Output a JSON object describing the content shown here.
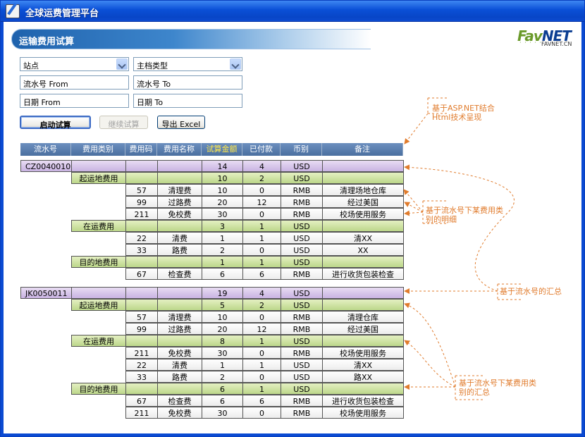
{
  "window": {
    "title": "全球运费管理平台"
  },
  "page": {
    "title": "运输费用试算"
  },
  "logo": {
    "text_fav": "Fav",
    "text_net": "NET",
    "sub": "FAVNET.CN"
  },
  "filters": {
    "site": {
      "value": "站点"
    },
    "master_type": {
      "value": "主档类型"
    },
    "serial_from": {
      "placeholder": "流水号 From"
    },
    "serial_to": {
      "placeholder": "流水号 To"
    },
    "date_from": {
      "placeholder": "日期 From"
    },
    "date_to": {
      "placeholder": "日期 To"
    }
  },
  "buttons": {
    "start": "启动试算",
    "continue": "继续试算",
    "export": "导出 Excel"
  },
  "table": {
    "headers": [
      "流水号",
      "费用类别",
      "费用码",
      "费用名称",
      "试算金额",
      "已付款",
      "币别",
      "备注"
    ],
    "groups": [
      {
        "serial": "CZ0040010",
        "amount": "14",
        "paid": "4",
        "currency": "USD",
        "categories": [
          {
            "name": "起运地费用",
            "amount": "10",
            "paid": "2",
            "currency": "USD",
            "items": [
              {
                "code": "57",
                "name": "清理费",
                "amount": "10",
                "paid": "0",
                "currency": "RMB",
                "remark": "清理场地仓库"
              },
              {
                "code": "99",
                "name": "过路费",
                "amount": "20",
                "paid": "12",
                "currency": "RMB",
                "remark": "经过美国"
              },
              {
                "code": "211",
                "name": "免校费",
                "amount": "30",
                "paid": "0",
                "currency": "RMB",
                "remark": "校场使用服务"
              }
            ]
          },
          {
            "name": "在运费用",
            "amount": "3",
            "paid": "1",
            "currency": "USD",
            "items": [
              {
                "code": "22",
                "name": "清费",
                "amount": "1",
                "paid": "1",
                "currency": "USD",
                "remark": "清XX"
              },
              {
                "code": "33",
                "name": "路费",
                "amount": "2",
                "paid": "0",
                "currency": "USD",
                "remark": "XX"
              }
            ]
          },
          {
            "name": "目的地费用",
            "amount": "1",
            "paid": "1",
            "currency": "USD",
            "items": [
              {
                "code": "67",
                "name": "检查费",
                "amount": "6",
                "paid": "6",
                "currency": "RMB",
                "remark": "进行收货包装检查"
              }
            ]
          }
        ]
      },
      {
        "serial": "JK0050011",
        "amount": "19",
        "paid": "4",
        "currency": "USD",
        "categories": [
          {
            "name": "起运地费用",
            "amount": "5",
            "paid": "2",
            "currency": "USD",
            "items": [
              {
                "code": "57",
                "name": "清理费",
                "amount": "10",
                "paid": "0",
                "currency": "RMB",
                "remark": "清理仓库"
              },
              {
                "code": "99",
                "name": "过路费",
                "amount": "20",
                "paid": "12",
                "currency": "RMB",
                "remark": "经过美国"
              }
            ]
          },
          {
            "name": "在运费用",
            "amount": "8",
            "paid": "1",
            "currency": "USD",
            "items": [
              {
                "code": "211",
                "name": "免校费",
                "amount": "30",
                "paid": "0",
                "currency": "RMB",
                "remark": "校场使用服务"
              },
              {
                "code": "22",
                "name": "清费",
                "amount": "1",
                "paid": "1",
                "currency": "USD",
                "remark": "清XX"
              },
              {
                "code": "33",
                "name": "路费",
                "amount": "2",
                "paid": "0",
                "currency": "USD",
                "remark": "路XX"
              }
            ]
          },
          {
            "name": "目的地费用",
            "amount": "6",
            "paid": "1",
            "currency": "USD",
            "items": [
              {
                "code": "67",
                "name": "检查费",
                "amount": "6",
                "paid": "6",
                "currency": "RMB",
                "remark": "进行收货包装检查"
              },
              {
                "code": "211",
                "name": "免校费",
                "amount": "30",
                "paid": "0",
                "currency": "RMB",
                "remark": "校场使用服务"
              }
            ]
          }
        ]
      }
    ]
  },
  "annotations": {
    "asp": "基于ASP.NET结合Html技术呈现",
    "detail": "基于流水号下某费用类别的明细",
    "serial_sum": "基于流水号的汇总",
    "category_sum": "基于流水号下某费用类别的汇总"
  },
  "colors": {
    "title_bar": "#0a4fd6",
    "header_row": "#4a6f9f",
    "amount_header_text": "#ffe84a",
    "serial_row": "#c9b3e2",
    "category_row": "#bcd78a",
    "annotation": "#e07b2c"
  }
}
